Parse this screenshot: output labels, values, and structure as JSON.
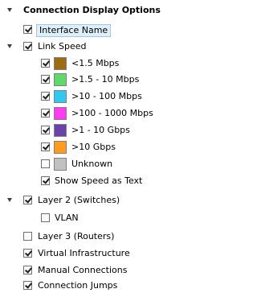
{
  "panel": {
    "title": "Connection Display Options",
    "items": {
      "interface_name": "Interface Name",
      "link_speed": "Link Speed",
      "speed_1": "<1.5 Mbps",
      "speed_2": ">1.5 - 10 Mbps",
      "speed_3": ">10 - 100 Mbps",
      "speed_4": ">100 - 1000 Mbps",
      "speed_5": ">1 - 10 Gbps",
      "speed_6": ">10 Gbps",
      "speed_7": "Unknown",
      "show_speed": "Show Speed as Text",
      "layer2": "Layer 2 (Switches)",
      "vlan": "VLAN",
      "layer3": "Layer 3 (Routers)",
      "virtual": "Virtual Infrastructure",
      "manual": "Manual Connections",
      "jumps": "Connection Jumps"
    }
  },
  "colors": {
    "speed_1": "#9a6d12",
    "speed_2": "#61d96a",
    "speed_3": "#31c9f1",
    "speed_4": "#ff3cf0",
    "speed_5": "#6a43a8",
    "speed_6": "#ff9b1d",
    "speed_7": "#c1c1c1"
  }
}
